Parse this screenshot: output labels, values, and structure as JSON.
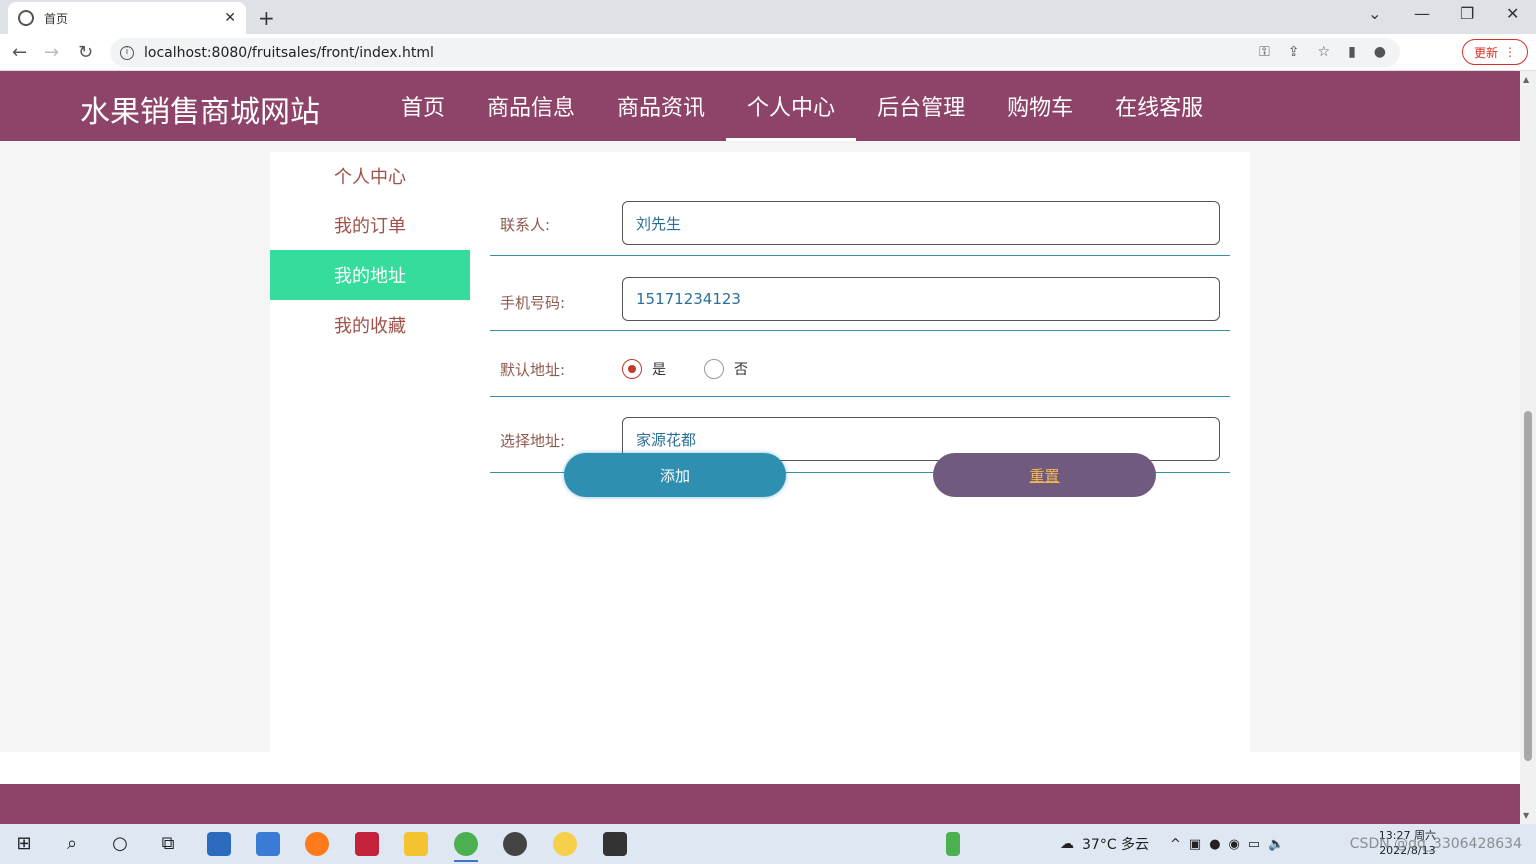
{
  "browser": {
    "tab_title": "首页",
    "url": "localhost:8080/fruitsales/front/index.html",
    "update_label": "更新"
  },
  "site": {
    "brand": "水果销售商城网站",
    "nav": [
      {
        "label": "首页",
        "active": false
      },
      {
        "label": "商品信息",
        "active": false
      },
      {
        "label": "商品资讯",
        "active": false
      },
      {
        "label": "个人中心",
        "active": true
      },
      {
        "label": "后台管理",
        "active": false
      },
      {
        "label": "购物车",
        "active": false
      },
      {
        "label": "在线客服",
        "active": false
      }
    ]
  },
  "sidemenu": [
    {
      "label": "个人中心",
      "active": false
    },
    {
      "label": "我的订单",
      "active": false
    },
    {
      "label": "我的地址",
      "active": true
    },
    {
      "label": "我的收藏",
      "active": false
    }
  ],
  "form": {
    "contact_label": "联系人:",
    "contact_value": "刘先生",
    "phone_label": "手机号码:",
    "phone_value": "15171234123",
    "default_label": "默认地址:",
    "default_yes": "是",
    "default_no": "否",
    "default_selected": "是",
    "address_label": "选择地址:",
    "address_value": "家源花都",
    "add_button": "添加",
    "reset_button": "重置"
  },
  "taskbar": {
    "weather": "37°C 多云",
    "time": "13:27 周六",
    "date": "2022/8/13",
    "watermark": "CSDN @qq_3306428634"
  },
  "colors": {
    "header": "#8e4369",
    "active_menu": "#35dc9c",
    "add_button": "#2f8fb0",
    "reset_button": "#705a80"
  }
}
